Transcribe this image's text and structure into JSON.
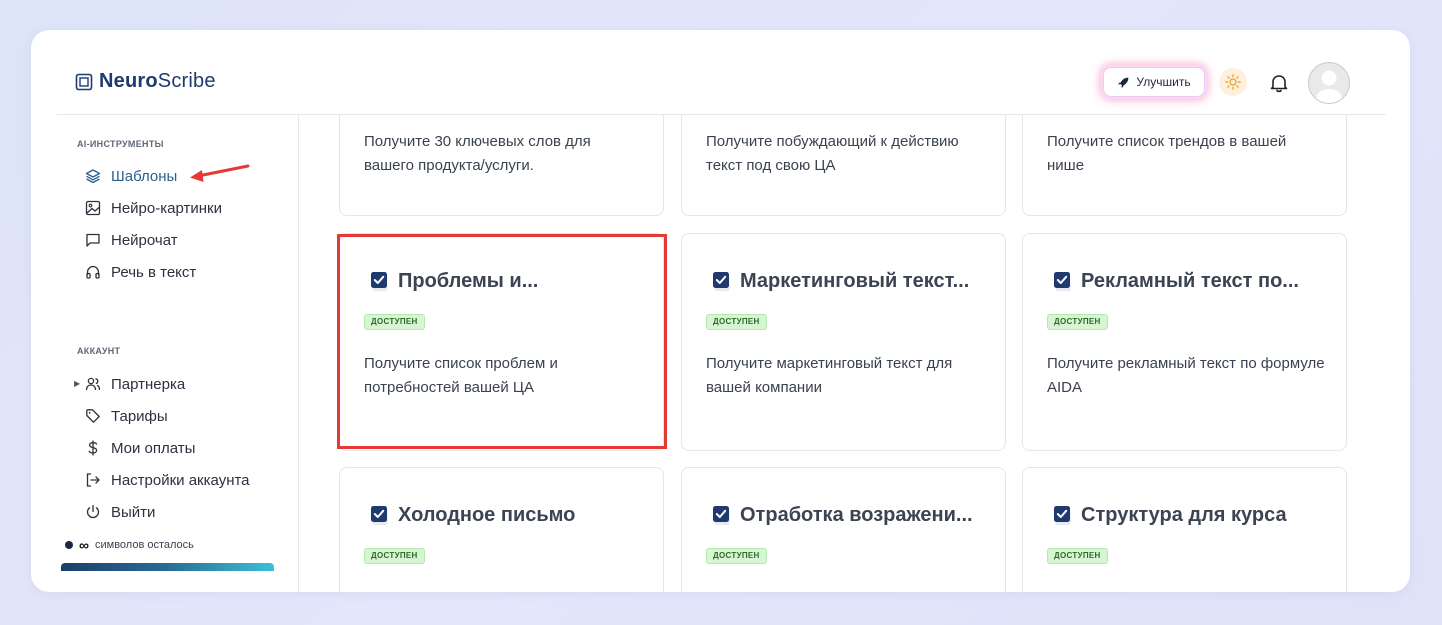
{
  "brand": {
    "name_bold": "Neuro",
    "name_regular": "Scribe"
  },
  "header": {
    "upgrade_label": "Улучшить"
  },
  "sidebar": {
    "section_tools": "AI-ИНСТРУМЕНТЫ",
    "tools": [
      {
        "label": "Шаблоны",
        "icon": "layers-icon",
        "active": true
      },
      {
        "label": "Нейро-картинки",
        "icon": "image-icon"
      },
      {
        "label": "Нейрочат",
        "icon": "chat-icon"
      },
      {
        "label": "Речь в текст",
        "icon": "headphones-icon"
      }
    ],
    "section_account": "АККАУНТ",
    "account": [
      {
        "label": "Партнерка",
        "icon": "users-icon"
      },
      {
        "label": "Тарифы",
        "icon": "tag-icon"
      },
      {
        "label": "Мои оплаты",
        "icon": "dollar-icon"
      },
      {
        "label": "Настройки аккаунта",
        "icon": "logout-icon"
      },
      {
        "label": "Выйти",
        "icon": "power-icon"
      }
    ],
    "credits_symbol": "∞",
    "credits_text": "символов осталось"
  },
  "cards_top": [
    {
      "desc": "Получите 30 ключевых слов для вашего продукта/услуги."
    },
    {
      "desc": "Получите побуждающий к действию текст под свою ЦА"
    },
    {
      "desc": "Получите список трендов в вашей нише"
    }
  ],
  "cards_mid": [
    {
      "title": "Проблемы и...",
      "badge": "ДОСТУПЕН",
      "desc": "Получите список проблем и потребностей вашей ЦА"
    },
    {
      "title": "Маркетинговый текст...",
      "badge": "ДОСТУПЕН",
      "desc": "Получите маркетинговый текст для вашей компании"
    },
    {
      "title": "Рекламный текст по...",
      "badge": "ДОСТУПЕН",
      "desc": "Получите рекламный текст по формуле AIDA"
    }
  ],
  "cards_bottom": [
    {
      "title": "Холодное письмо",
      "badge": "ДОСТУПЕН"
    },
    {
      "title": "Отработка возражени...",
      "badge": "ДОСТУПЕН"
    },
    {
      "title": "Структура для курса",
      "badge": "ДОСТУПЕН"
    }
  ],
  "colors": {
    "accent": "#2a5f8e",
    "highlight": "#e53935",
    "badge_bg": "#d8f5d3"
  }
}
